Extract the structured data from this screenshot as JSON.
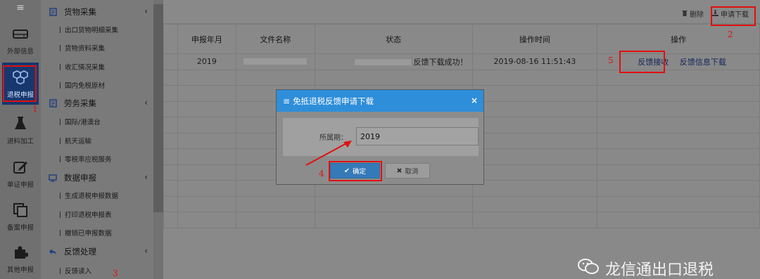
{
  "rail": {
    "menu_toggle": "≡",
    "items": [
      {
        "label": "外部信息",
        "icon": "drive-icon"
      },
      {
        "label": "退税申报",
        "icon": "cubes-icon"
      },
      {
        "label": "进料加工",
        "icon": "flask-icon"
      },
      {
        "label": "单证申报",
        "icon": "edit-icon"
      },
      {
        "label": "备案申报",
        "icon": "copy-icon"
      },
      {
        "label": "其他申报",
        "icon": "puzzle-icon"
      }
    ]
  },
  "menu": {
    "groups": [
      {
        "label": "货物采集",
        "icon": "document-icon",
        "chevron": "‹"
      },
      {
        "label": "劳务采集",
        "icon": "document-icon",
        "chevron": "‹"
      },
      {
        "label": "数据申报",
        "icon": "monitor-icon",
        "chevron": "‹"
      },
      {
        "label": "反馈处理",
        "icon": "reply-icon",
        "chevron": "‹"
      }
    ],
    "goods_items": [
      "出口货物明细采集",
      "货物资料采集",
      "收汇情况采集",
      "国内免税原材"
    ],
    "labor_items": [
      "国际/港澳台",
      "航天运输",
      "零税率应税服务"
    ],
    "data_items": [
      "生成退税申报数据",
      "打印退税申报表",
      "撤销已申报数据"
    ],
    "feedback_items": [
      "反馈读入"
    ]
  },
  "toolbar": {
    "delete_label": "删除",
    "apply_download_label": "申请下载"
  },
  "table": {
    "headers": [
      "申报年月",
      "文件名称",
      "状态",
      "操作时间",
      "操作"
    ],
    "row": {
      "period": "2019",
      "status": "反馈下载成功！",
      "time": "2019-08-16 11:51:43",
      "actions": [
        "反馈接收",
        "反馈信息下载"
      ]
    }
  },
  "dialog": {
    "title": "免抵退税反馈申请下载",
    "close": "×",
    "field_label": "所属期：",
    "field_value": "2019",
    "ok_label": "确定",
    "cancel_label": "取消"
  },
  "annotations": {
    "n1": "1",
    "n2": "2",
    "n3": "3",
    "n4": "4",
    "n5": "5"
  },
  "watermark": {
    "text": "龙信通出口退税",
    "icon": "wechat-icon"
  }
}
